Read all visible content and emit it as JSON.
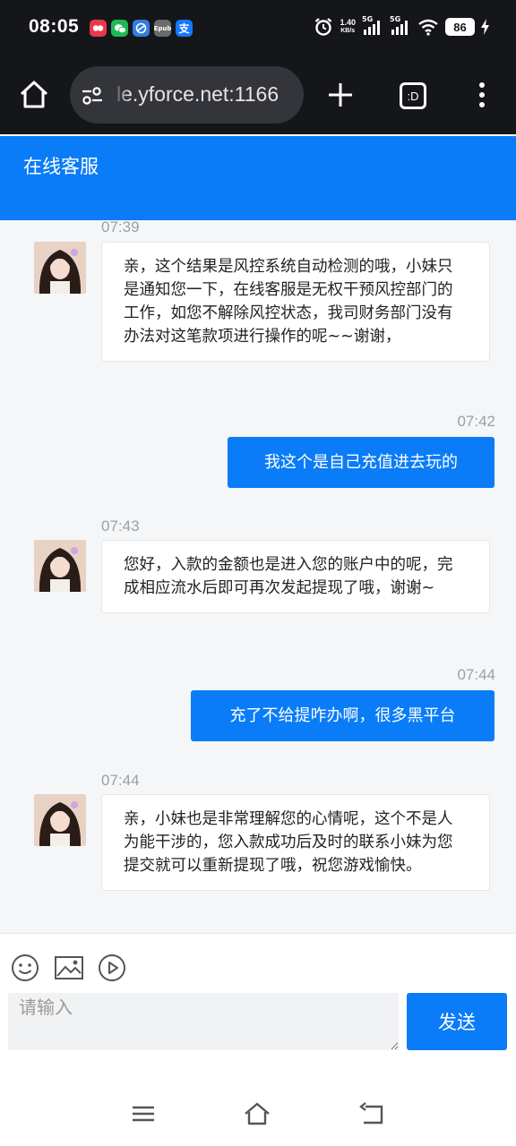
{
  "status_bar": {
    "time": "08:05",
    "net_speed_value": "1.40",
    "net_speed_unit": "KB/s",
    "signal_1": "5G",
    "signal_2": "5G",
    "battery": "86",
    "app_icons": [
      {
        "icon": "notification-app-red-icon",
        "color": "#e8394a"
      },
      {
        "icon": "wechat-icon",
        "color": "#1db954"
      },
      {
        "icon": "browser-app-icon",
        "color": "#2f7de1"
      },
      {
        "icon": "epub-app-icon",
        "color": "#6b6b6b",
        "text": "Epub"
      },
      {
        "icon": "alipay-icon",
        "color": "#1677ff",
        "text": "支"
      }
    ]
  },
  "browser": {
    "url_text": "le.yforce.net:1166",
    "tabs_label": ":D"
  },
  "header": {
    "title": "在线客服"
  },
  "messages": [
    {
      "type": "in",
      "time": "07:39",
      "text": "亲，这个结果是风控系统自动检测的哦，小妹只是通知您一下，在线客服是无权干预风控部门的工作，如您不解除风控状态，我司财务部门没有办法对这笔款项进行操作的呢~~谢谢，"
    },
    {
      "type": "out",
      "time": "07:42",
      "text": "我这个是自己充值进去玩的"
    },
    {
      "type": "in",
      "time": "07:43",
      "text": "您好，入款的金额也是进入您的账户中的呢，完成相应流水后即可再次发起提现了哦，谢谢~"
    },
    {
      "type": "out",
      "time": "07:44",
      "text": "充了不给提咋办啊，很多黑平台"
    },
    {
      "type": "in",
      "time": "07:44",
      "text": "亲，小妹也是非常理解您的心情呢，这个不是人为能干涉的，您入款成功后及时的联系小妹为您提交就可以重新提现了哦，祝您游戏愉快。"
    }
  ],
  "input": {
    "placeholder": "请输入",
    "send_label": "发送"
  },
  "colors": {
    "accent": "#0a7cf7",
    "status_bg": "#15161a",
    "chat_bg": "#f5f6f7"
  }
}
